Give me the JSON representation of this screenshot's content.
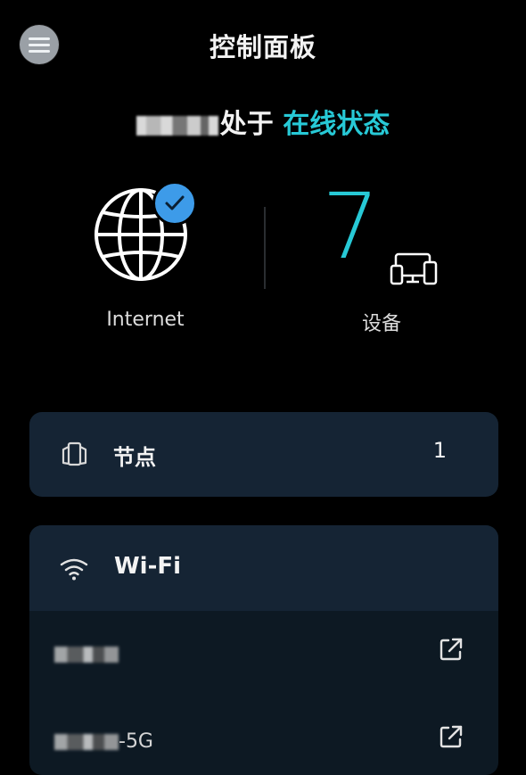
{
  "header": {
    "title": "控制面板",
    "menu_icon": "hamburger-menu-icon"
  },
  "status": {
    "prefix_hidden": "",
    "text": "处于",
    "online_text": "在线状态",
    "online_color": "#27c9d6"
  },
  "internet": {
    "label": "Internet",
    "icon": "globe-icon",
    "badge_icon": "check-icon",
    "badge_color": "#3d9be9"
  },
  "devices": {
    "count": "7",
    "label": "设备",
    "icon": "devices-icon",
    "count_color": "#27c9d6"
  },
  "nodes": {
    "label": "节点",
    "count": "1",
    "icon": "node-router-icon"
  },
  "wifi": {
    "title": "Wi-Fi",
    "icon": "wifi-icon",
    "networks": [
      {
        "name_suffix": "",
        "link_icon": "external-link-icon"
      },
      {
        "name_suffix": "-5G",
        "link_icon": "external-link-icon"
      }
    ]
  },
  "colors": {
    "background": "#000000",
    "card": "#152434",
    "card_dark": "#0d1923"
  }
}
